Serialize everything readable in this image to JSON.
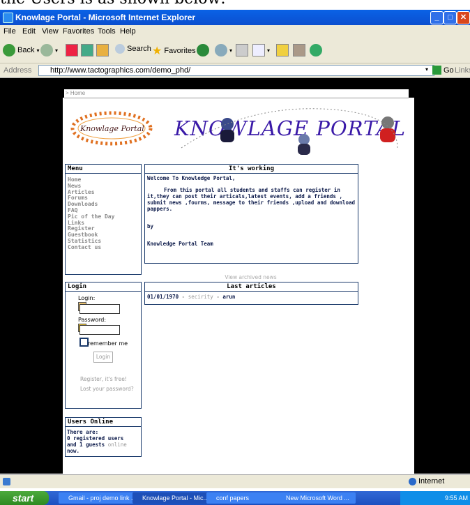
{
  "doc_caption": "the Users is as shown below:",
  "window": {
    "title": "Knowlage Portal - Microsoft Internet Explorer"
  },
  "menubar": [
    "File",
    "Edit",
    "View",
    "Favorites",
    "Tools",
    "Help"
  ],
  "toolbar": {
    "back": "Back",
    "search": "Search",
    "favorites": "Favorites"
  },
  "address": {
    "label": "Address",
    "url": "http://www.tactographics.com/demo_phd/",
    "go": "Go",
    "links": "Links"
  },
  "breadcrumb": "> Home",
  "banner": {
    "logo_text": "Knowlage Portal",
    "heading": "KNOWLAGE PORTAL"
  },
  "menu": {
    "title": "Menu",
    "items": [
      "Home",
      "News",
      "Articles",
      "Forums",
      "Downloads",
      "FAQ",
      "Pic of the Day",
      "Links",
      "Register",
      "Guestbook",
      "Statistics",
      "Contact us"
    ]
  },
  "news": {
    "title": "It's working",
    "welcome": "Welcome To Knowledge Portal,",
    "body": "From this portal all students and staffs can register in it,they can post their articals,latest events, add a friends , submit news ,fourms, message to their friends ,upload and download pappers.",
    "by": "by",
    "team": "Knowledge Portal Team",
    "archive_link": "View archived news"
  },
  "articles": {
    "title": "Last articles",
    "date": "01/01/1970",
    "category": "secirity",
    "sep": "-",
    "author": "arun"
  },
  "login": {
    "title": "Login",
    "login_label": "Login:",
    "password_label": "Password:",
    "remember": "remember me",
    "button": "Login",
    "register": "Register, it's free!",
    "lost": "Lost your password?"
  },
  "users_online": {
    "title": "Users Online",
    "line1": "There are:",
    "line2": "0 registered users",
    "line3a": "and 1 guests",
    "line3b": "online",
    "line3c": "now."
  },
  "status": {
    "zone": "Internet"
  },
  "taskbar": {
    "start": "start",
    "tasks": [
      "Gmail - proj demo link ...",
      "Knowlage Portal - Mic...",
      "conf papers",
      "New Microsoft Word ..."
    ],
    "clock": "9:55 AM"
  }
}
